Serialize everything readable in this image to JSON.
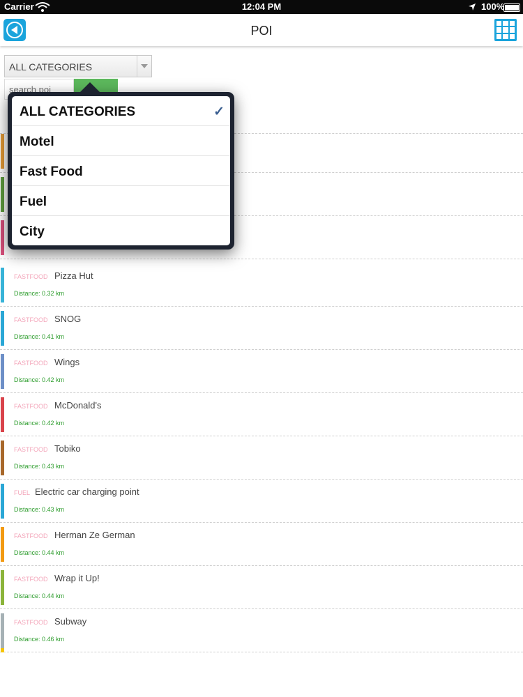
{
  "status_bar": {
    "carrier": "Carrier",
    "time": "12:04 PM",
    "battery": "100%"
  },
  "nav": {
    "title": "POI",
    "back_icon": "back-arrow-circle-icon",
    "menu_icon": "grid-icon"
  },
  "filter": {
    "selected": "ALL CATEGORIES",
    "search_placeholder": "search poi"
  },
  "dropdown": {
    "options": [
      {
        "label": "ALL CATEGORIES",
        "checked": true
      },
      {
        "label": "Motel",
        "checked": false
      },
      {
        "label": "Fast Food",
        "checked": false
      },
      {
        "label": "Fuel",
        "checked": false
      },
      {
        "label": "City",
        "checked": false
      }
    ],
    "check_mark": "✓"
  },
  "hidden_rows": [
    {
      "color": "#e39a37"
    },
    {
      "color": "#5e9c3e"
    },
    {
      "color": "#d9507c"
    }
  ],
  "poi": [
    {
      "category": "FASTFOOD",
      "name": "Pizza Hut",
      "distance": "Distance: 0.32 km",
      "color": "#37b3d8"
    },
    {
      "category": "FASTFOOD",
      "name": "SNOG",
      "distance": "Distance: 0.41 km",
      "color": "#2aa7d6"
    },
    {
      "category": "FASTFOOD",
      "name": "Wings",
      "distance": "Distance: 0.42 km",
      "color": "#6d8fc7"
    },
    {
      "category": "FASTFOOD",
      "name": "McDonald's",
      "distance": "Distance: 0.42 km",
      "color": "#d9434b"
    },
    {
      "category": "FASTFOOD",
      "name": "Tobiko",
      "distance": "Distance: 0.43 km",
      "color": "#a8682b"
    },
    {
      "category": "FUEL",
      "name": "Electric car charging point",
      "distance": "Distance: 0.43 km",
      "color": "#2aa7d6"
    },
    {
      "category": "FASTFOOD",
      "name": "Herman Ze German",
      "distance": "Distance: 0.44 km",
      "color": "#f29a12"
    },
    {
      "category": "FASTFOOD",
      "name": "Wrap it Up!",
      "distance": "Distance: 0.44 km",
      "color": "#8bb43a"
    },
    {
      "category": "FASTFOOD",
      "name": "Subway",
      "distance": "Distance: 0.46 km",
      "color": "#a6b1b5"
    }
  ]
}
